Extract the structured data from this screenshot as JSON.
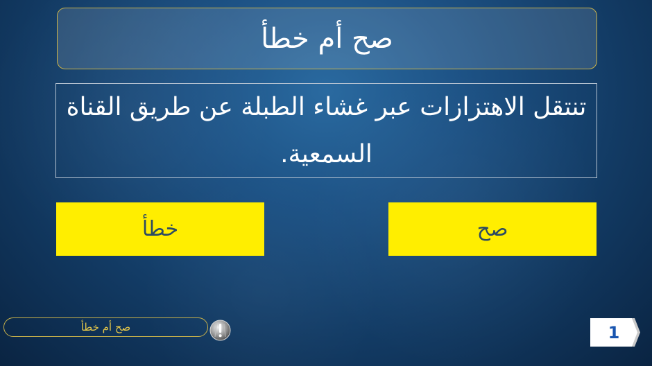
{
  "header": {
    "title": "صح أم خطأ"
  },
  "question": {
    "text": "تنتقل الاهتزازات عبر غشاء الطبلة عن طريق القناة السمعية."
  },
  "answers": {
    "false_label": "خطأ",
    "true_label": "صح"
  },
  "footer": {
    "label": "صح أم خطأ",
    "info_icon": "exclamation-icon",
    "page_number": "1"
  },
  "colors": {
    "answer_bg": "#ffee00",
    "answer_text": "#2d4b62",
    "accent_border": "#c9b24a",
    "footer_text": "#e6c84a",
    "page_number": "#1a56b0"
  }
}
